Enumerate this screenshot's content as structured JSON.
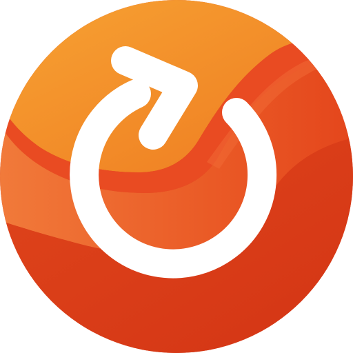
{
  "icon": {
    "semantic_name": "refresh-icon",
    "glyph": "circular-arrow-clockwise"
  },
  "colors": {
    "orange_light": "#F59B2E",
    "orange_mid": "#EF7622",
    "red_orange": "#E94B22",
    "red_deep": "#D93A17",
    "accent_band": "#DE4018",
    "symbol": "#FFFFFF"
  }
}
